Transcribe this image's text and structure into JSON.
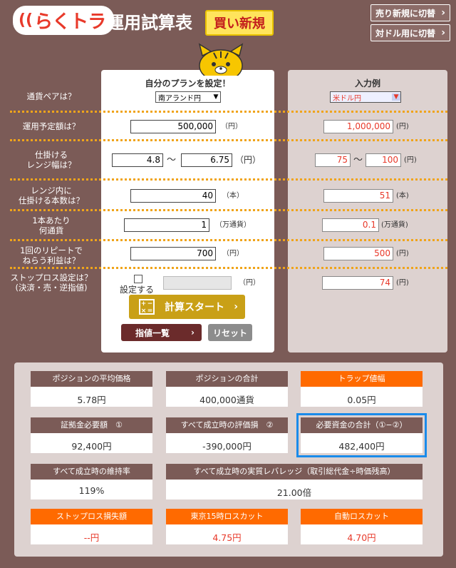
{
  "header": {
    "logo_marks": "((",
    "logo_text": "らくトラ",
    "title": "運用試算表",
    "mode_badge": "買い新規",
    "switch_sell": "売り新規に切替",
    "switch_usd": "対ドル用に切替"
  },
  "form": {
    "heading": "自分のプランを設定！",
    "currency_pair": "南アランド円",
    "capital": "500,000",
    "capital_unit": "（円）",
    "range_low": "4.8",
    "range_high": "6.75",
    "range_unit": "（円）",
    "range_sep": "〜",
    "count": "40",
    "count_unit": "（本）",
    "per_order": "1",
    "per_order_unit": "（万通貨）",
    "profit": "700",
    "profit_unit": "（円）",
    "stoploss_check_label": "設定する",
    "stoploss_value": "",
    "stoploss_unit": "（円）"
  },
  "example": {
    "heading": "入力例",
    "currency_pair": "米ドル円",
    "capital": "1,000,000",
    "capital_unit": "(円)",
    "range_low": "75",
    "range_high": "100",
    "range_unit": "(円)",
    "range_sep": "〜",
    "count": "51",
    "count_unit": "(本)",
    "per_order": "0.1",
    "per_order_unit": "(万通貨)",
    "profit": "500",
    "profit_unit": "(円)",
    "stoploss": "74",
    "stoploss_unit": "(円)"
  },
  "questions": {
    "q1": "通貨ペアは？",
    "q2": "運用予定額は？",
    "q3a": "仕掛ける",
    "q3b": "レンジ幅は？",
    "q4a": "レンジ内に",
    "q4b": "仕掛ける本数は？",
    "q5a": "1本あたり",
    "q5b": "何通貨",
    "q6a": "1回のリピートで",
    "q6b": "ねらう利益は？",
    "q7a": "ストップロス設定は？",
    "q7b": "(決済・売・逆指値)"
  },
  "buttons": {
    "calc": "計算スタート",
    "list": "指値一覧",
    "reset": "リセット"
  },
  "results": {
    "avg_price_label": "ポジションの平均価格",
    "avg_price": "5.78円",
    "position_total_label": "ポジションの合計",
    "position_total": "400,000通貨",
    "trap_width_label": "トラップ値幅",
    "trap_width": "0.05円",
    "margin_label": "証拠金必要額　①",
    "margin": "92,400円",
    "eval_loss_label": "すべて成立時の評価損　②",
    "eval_loss": "-390,000円",
    "required_label": "必要資金の合計（①−②）",
    "required": "482,400円",
    "maint_label": "すべて成立時の維持率",
    "maint": "119%",
    "leverage_label": "すべて成立時の実質レバレッジ（取引総代金÷時価残高）",
    "leverage": "21.00倍",
    "sl_loss_label": "ストップロス損失額",
    "sl_loss": "--円",
    "tokyo_label": "東京15時ロスカット",
    "tokyo": "4.75円",
    "auto_label": "自動ロスカット",
    "auto": "4.70円"
  }
}
